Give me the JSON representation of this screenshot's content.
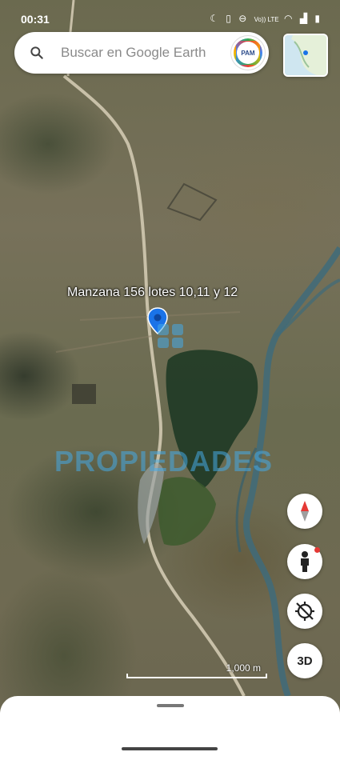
{
  "status_bar": {
    "time": "00:31",
    "icons": [
      "moon-icon",
      "vibrate-icon",
      "dnd-icon",
      "volte-icon",
      "wifi-icon",
      "signal-icon",
      "battery-icon"
    ],
    "volte_text": "Vo)) LTE"
  },
  "search": {
    "placeholder": "Buscar en Google Earth",
    "avatar_text": "PAM"
  },
  "map": {
    "placemark_label": "Manzana 156 lotes 10,11 y 12",
    "watermark": "PROPIEDADES",
    "scale_label": "1,000 m"
  },
  "controls": {
    "compass": "compass-icon",
    "pegman": "pegman-icon",
    "location": "my-location-off-icon",
    "three_d": "3D"
  },
  "colors": {
    "accent_blue": "#1a73e8",
    "watermark": "#46aae6",
    "sheet": "#ffffff"
  }
}
